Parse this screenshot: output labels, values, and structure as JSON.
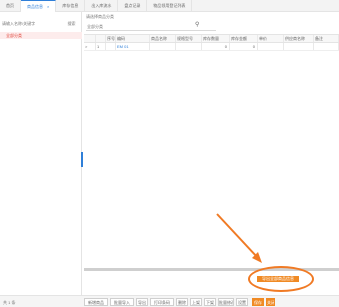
{
  "tabs": [
    {
      "label": "首页",
      "active": false
    },
    {
      "label": "商品信息",
      "active": true,
      "close": "×"
    },
    {
      "label": "库存信息",
      "active": false
    },
    {
      "label": "出入库流水",
      "active": false
    },
    {
      "label": "盘点记录",
      "active": false
    },
    {
      "label": "物品领用登记列表",
      "active": false
    }
  ],
  "left": {
    "search_placeholder": "请输入名称/关键字",
    "search_button": "搜索",
    "tree_item": "全部分类"
  },
  "filter": {
    "title": "请选择商品分类",
    "select_value": "全部分类",
    "search_icon": "search-icon"
  },
  "grid": {
    "headers": [
      "",
      "",
      "序号",
      "编码",
      "商品名称",
      "规格型号",
      "库存数量",
      "库存金额",
      "单价",
      "供应商名称",
      "备注"
    ],
    "row": {
      "toggle": ">",
      "index": "1",
      "code": "EM 01",
      "qty": "0",
      "amount": "0"
    }
  },
  "highlight_button": "导出全部商品信息",
  "bottom_bar": {
    "left_text": "共 1 条",
    "buttons": [
      "新增商品",
      "批量导入",
      "导出",
      "打印条码",
      "删除",
      "上架",
      "下架",
      "批量修改",
      "设置"
    ],
    "primary_buttons": [
      "保存",
      "关闭"
    ]
  },
  "colors": {
    "accent": "#2f7fd8",
    "orange": "#f08a24",
    "selected_tree": "#e0453a"
  }
}
